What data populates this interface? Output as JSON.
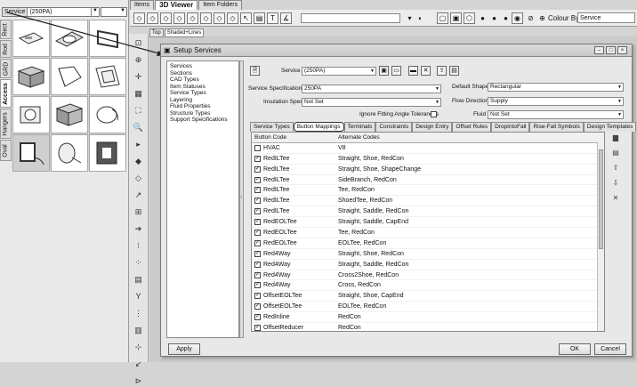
{
  "left_panel": {
    "service_label": "Service",
    "service_value": "(250PA)",
    "vertical_tabs": [
      "Rect",
      "Rod",
      "GRD",
      "Access",
      "Hangers",
      "Oval"
    ]
  },
  "top_tabs": [
    "Items",
    "3D Viewer",
    "Item Folders"
  ],
  "toolbar": {
    "colour_by_label": "Colour By",
    "colour_by_value": "Service"
  },
  "view_buttons": [
    "Top",
    "Shaded+Lines"
  ],
  "dialog": {
    "title": "Setup Services",
    "tree_items": [
      "Services",
      "Sections",
      "CAD Types",
      "Item Statuses",
      "Service Types",
      "Layering",
      "Fluid Properties",
      "Structure Types",
      "Support Specifications"
    ],
    "service_label": "Service",
    "service_value": "(250PA)",
    "service_spec_label": "Service Specification",
    "service_spec_value": "250PA",
    "insulation_spec_label": "Insulation Spec",
    "insulation_spec_value": "Not Set",
    "default_shape_label": "Default Shape",
    "default_shape_value": "Rectangular",
    "flow_direction_label": "Flow Direction",
    "flow_direction_value": "Supply",
    "ignore_fitting_label": "Ignore Fitting Angle Tolerances",
    "fluid_label": "Fluid",
    "fluid_value": "Not Set",
    "tabs": [
      "Service Types",
      "Button Mappings",
      "Terminals",
      "Constraints",
      "Design Entry",
      "Offset Rules",
      "DropIntoFall",
      "Rise-Fall Symbols",
      "Design Templates"
    ],
    "grid_headers": [
      "Button Code",
      "Alternate Codes"
    ],
    "grid_rows": [
      {
        "code": "HVAC",
        "alt": "V8",
        "checked": false
      },
      {
        "code": "RedILTee",
        "alt": "Straight, Shoe, RedCon",
        "checked": true
      },
      {
        "code": "RedILTee",
        "alt": "Straight, Shoe, ShapeChange",
        "checked": true
      },
      {
        "code": "RedILTee",
        "alt": "SideBranch, RedCon",
        "checked": true
      },
      {
        "code": "RedILTee",
        "alt": "Tee, RedCon",
        "checked": true
      },
      {
        "code": "RedILTee",
        "alt": "ShoedTee, RedCon",
        "checked": true
      },
      {
        "code": "RedILTee",
        "alt": "Straight, Saddle, RedCon",
        "checked": true
      },
      {
        "code": "RedEOLTee",
        "alt": "Straight, Saddle, CapEnd",
        "checked": true
      },
      {
        "code": "RedEOLTee",
        "alt": "Tee, RedCon",
        "checked": true
      },
      {
        "code": "RedEOLTee",
        "alt": "EOLTee, RedCon",
        "checked": true
      },
      {
        "code": "Red4Way",
        "alt": "Straight, Shoe, RedCon",
        "checked": true
      },
      {
        "code": "Red4Way",
        "alt": "Straight, Saddle, RedCon",
        "checked": true
      },
      {
        "code": "Red4Way",
        "alt": "Cross2Shoe, RedCon",
        "checked": true
      },
      {
        "code": "Red4Way",
        "alt": "Cross, RedCon",
        "checked": true
      },
      {
        "code": "OffsetEOLTee",
        "alt": "Straight, Shoe, CapEnd",
        "checked": true
      },
      {
        "code": "OffsetEOLTee",
        "alt": "EOLTee, RedCon",
        "checked": true
      },
      {
        "code": "RedInline",
        "alt": "RedCon",
        "checked": true
      },
      {
        "code": "OffsetReducer",
        "alt": "RedCon",
        "checked": true
      }
    ],
    "apply_label": "Apply",
    "ok_label": "OK",
    "cancel_label": "Cancel"
  }
}
